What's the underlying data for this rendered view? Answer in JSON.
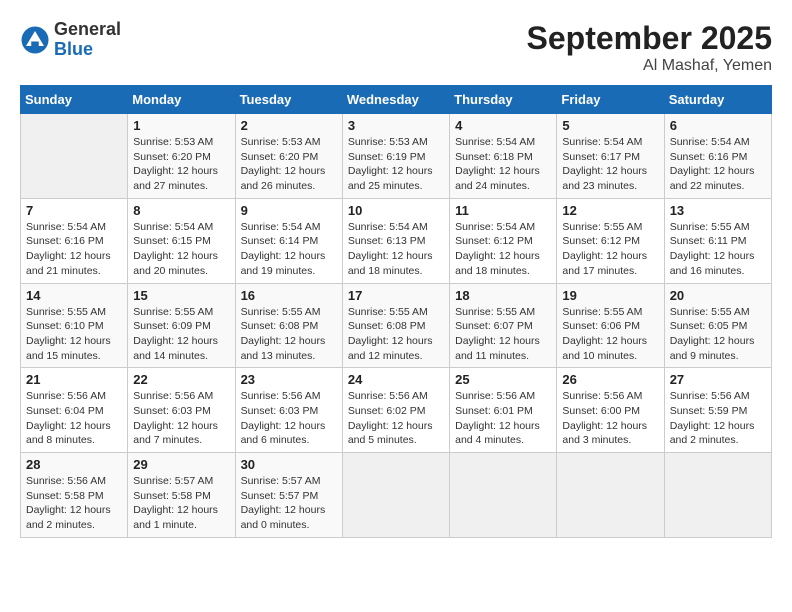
{
  "header": {
    "logo_general": "General",
    "logo_blue": "Blue",
    "month_year": "September 2025",
    "location": "Al Mashaf, Yemen"
  },
  "days_of_week": [
    "Sunday",
    "Monday",
    "Tuesday",
    "Wednesday",
    "Thursday",
    "Friday",
    "Saturday"
  ],
  "weeks": [
    [
      {
        "day": "",
        "info": ""
      },
      {
        "day": "1",
        "info": "Sunrise: 5:53 AM\nSunset: 6:20 PM\nDaylight: 12 hours\nand 27 minutes."
      },
      {
        "day": "2",
        "info": "Sunrise: 5:53 AM\nSunset: 6:20 PM\nDaylight: 12 hours\nand 26 minutes."
      },
      {
        "day": "3",
        "info": "Sunrise: 5:53 AM\nSunset: 6:19 PM\nDaylight: 12 hours\nand 25 minutes."
      },
      {
        "day": "4",
        "info": "Sunrise: 5:54 AM\nSunset: 6:18 PM\nDaylight: 12 hours\nand 24 minutes."
      },
      {
        "day": "5",
        "info": "Sunrise: 5:54 AM\nSunset: 6:17 PM\nDaylight: 12 hours\nand 23 minutes."
      },
      {
        "day": "6",
        "info": "Sunrise: 5:54 AM\nSunset: 6:16 PM\nDaylight: 12 hours\nand 22 minutes."
      }
    ],
    [
      {
        "day": "7",
        "info": "Sunrise: 5:54 AM\nSunset: 6:16 PM\nDaylight: 12 hours\nand 21 minutes."
      },
      {
        "day": "8",
        "info": "Sunrise: 5:54 AM\nSunset: 6:15 PM\nDaylight: 12 hours\nand 20 minutes."
      },
      {
        "day": "9",
        "info": "Sunrise: 5:54 AM\nSunset: 6:14 PM\nDaylight: 12 hours\nand 19 minutes."
      },
      {
        "day": "10",
        "info": "Sunrise: 5:54 AM\nSunset: 6:13 PM\nDaylight: 12 hours\nand 18 minutes."
      },
      {
        "day": "11",
        "info": "Sunrise: 5:54 AM\nSunset: 6:12 PM\nDaylight: 12 hours\nand 18 minutes."
      },
      {
        "day": "12",
        "info": "Sunrise: 5:55 AM\nSunset: 6:12 PM\nDaylight: 12 hours\nand 17 minutes."
      },
      {
        "day": "13",
        "info": "Sunrise: 5:55 AM\nSunset: 6:11 PM\nDaylight: 12 hours\nand 16 minutes."
      }
    ],
    [
      {
        "day": "14",
        "info": "Sunrise: 5:55 AM\nSunset: 6:10 PM\nDaylight: 12 hours\nand 15 minutes."
      },
      {
        "day": "15",
        "info": "Sunrise: 5:55 AM\nSunset: 6:09 PM\nDaylight: 12 hours\nand 14 minutes."
      },
      {
        "day": "16",
        "info": "Sunrise: 5:55 AM\nSunset: 6:08 PM\nDaylight: 12 hours\nand 13 minutes."
      },
      {
        "day": "17",
        "info": "Sunrise: 5:55 AM\nSunset: 6:08 PM\nDaylight: 12 hours\nand 12 minutes."
      },
      {
        "day": "18",
        "info": "Sunrise: 5:55 AM\nSunset: 6:07 PM\nDaylight: 12 hours\nand 11 minutes."
      },
      {
        "day": "19",
        "info": "Sunrise: 5:55 AM\nSunset: 6:06 PM\nDaylight: 12 hours\nand 10 minutes."
      },
      {
        "day": "20",
        "info": "Sunrise: 5:55 AM\nSunset: 6:05 PM\nDaylight: 12 hours\nand 9 minutes."
      }
    ],
    [
      {
        "day": "21",
        "info": "Sunrise: 5:56 AM\nSunset: 6:04 PM\nDaylight: 12 hours\nand 8 minutes."
      },
      {
        "day": "22",
        "info": "Sunrise: 5:56 AM\nSunset: 6:03 PM\nDaylight: 12 hours\nand 7 minutes."
      },
      {
        "day": "23",
        "info": "Sunrise: 5:56 AM\nSunset: 6:03 PM\nDaylight: 12 hours\nand 6 minutes."
      },
      {
        "day": "24",
        "info": "Sunrise: 5:56 AM\nSunset: 6:02 PM\nDaylight: 12 hours\nand 5 minutes."
      },
      {
        "day": "25",
        "info": "Sunrise: 5:56 AM\nSunset: 6:01 PM\nDaylight: 12 hours\nand 4 minutes."
      },
      {
        "day": "26",
        "info": "Sunrise: 5:56 AM\nSunset: 6:00 PM\nDaylight: 12 hours\nand 3 minutes."
      },
      {
        "day": "27",
        "info": "Sunrise: 5:56 AM\nSunset: 5:59 PM\nDaylight: 12 hours\nand 2 minutes."
      }
    ],
    [
      {
        "day": "28",
        "info": "Sunrise: 5:56 AM\nSunset: 5:58 PM\nDaylight: 12 hours\nand 2 minutes."
      },
      {
        "day": "29",
        "info": "Sunrise: 5:57 AM\nSunset: 5:58 PM\nDaylight: 12 hours\nand 1 minute."
      },
      {
        "day": "30",
        "info": "Sunrise: 5:57 AM\nSunset: 5:57 PM\nDaylight: 12 hours\nand 0 minutes."
      },
      {
        "day": "",
        "info": ""
      },
      {
        "day": "",
        "info": ""
      },
      {
        "day": "",
        "info": ""
      },
      {
        "day": "",
        "info": ""
      }
    ]
  ]
}
